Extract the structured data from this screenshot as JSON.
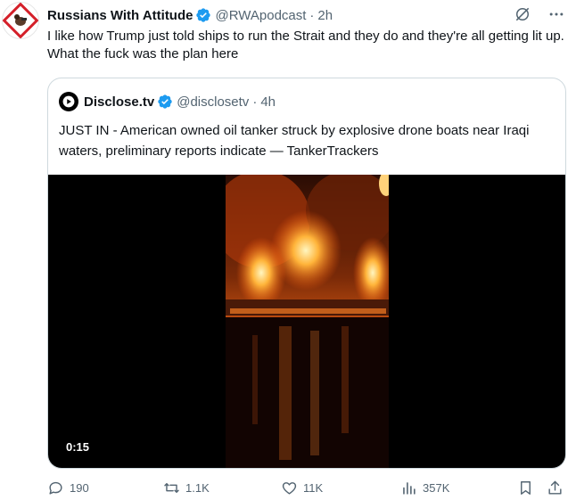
{
  "tweet": {
    "author_name": "Russians With Attitude",
    "handle": "@RWApodcast",
    "separator": "·",
    "time": "2h",
    "text": "I like how Trump just told ships to run the Strait and they do and they're all getting lit up. What the fuck was the plan here"
  },
  "quote": {
    "author_name": "Disclose.tv",
    "handle": "@disclosetv",
    "separator": "·",
    "time": "4h",
    "text": "JUST IN - American owned oil tanker struck by explosive drone boats near Iraqi waters, preliminary reports indicate — TankerTrackers",
    "video_duration": "0:15"
  },
  "actions": {
    "replies": "190",
    "reposts": "1.1K",
    "likes": "11K",
    "views": "357K"
  },
  "colors": {
    "verified": "#1d9bf0",
    "muted": "#536471",
    "border": "#cfd9de"
  }
}
